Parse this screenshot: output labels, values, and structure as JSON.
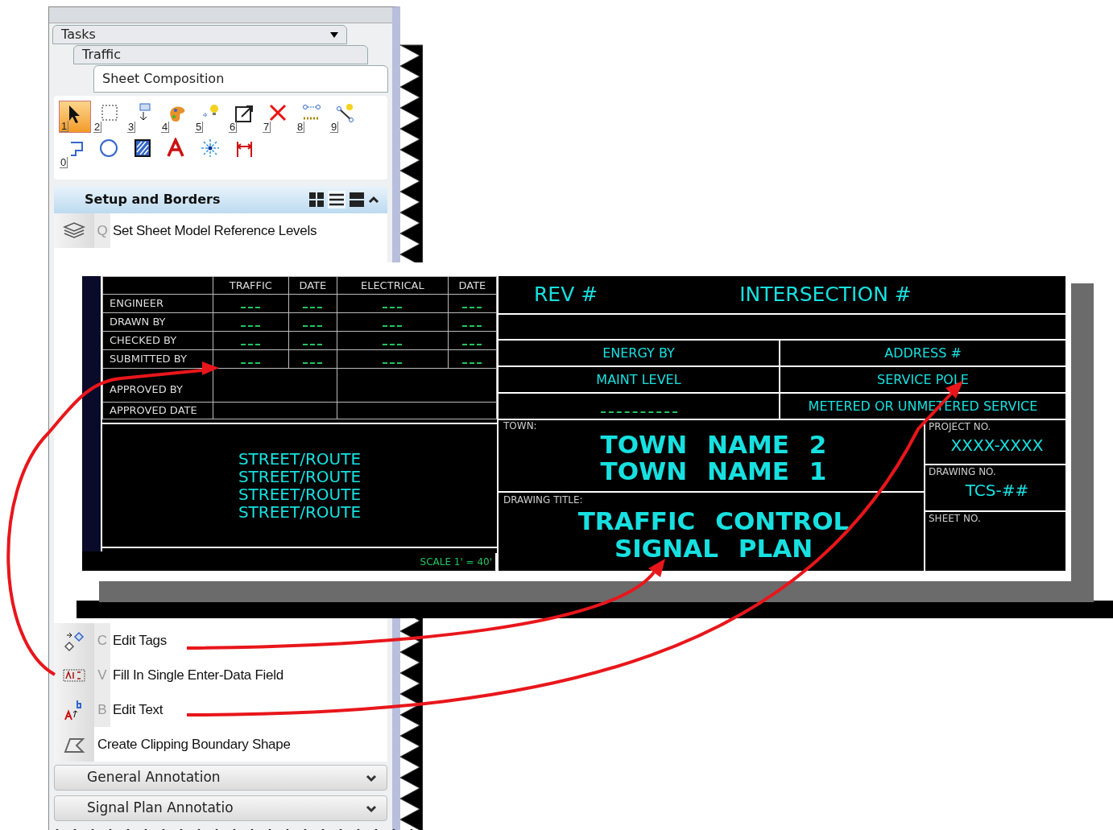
{
  "panel": {
    "task_path": [
      {
        "label": "Tasks",
        "selected": false
      },
      {
        "label": "Traffic",
        "selected": false
      },
      {
        "label": "Sheet Composition",
        "selected": true
      }
    ],
    "tools": [
      {
        "key": "1",
        "kind": "pointer",
        "selected": true
      },
      {
        "key": "2",
        "kind": "fence",
        "selected": false
      },
      {
        "key": "3",
        "kind": "place",
        "selected": false
      },
      {
        "key": "4",
        "kind": "palette",
        "selected": false
      },
      {
        "key": "5",
        "kind": "bulb",
        "selected": false
      },
      {
        "key": "6",
        "kind": "scale",
        "selected": false
      },
      {
        "key": "7",
        "kind": "delete",
        "selected": false
      },
      {
        "key": "8",
        "kind": "connect",
        "selected": false
      },
      {
        "key": "9",
        "kind": "link",
        "selected": false
      },
      {
        "key": "0",
        "kind": "shape",
        "selected": false
      },
      {
        "kind": "circle",
        "selected": false
      },
      {
        "kind": "hatch",
        "selected": false
      },
      {
        "kind": "text",
        "selected": false
      },
      {
        "kind": "snap",
        "selected": false
      },
      {
        "kind": "dimension",
        "selected": false
      }
    ],
    "section": {
      "title": "Setup and Borders",
      "expanded": true
    },
    "items": [
      {
        "key": "Q",
        "label": "Set Sheet Model Reference Levels",
        "kind": "layers"
      },
      {
        "key": "C",
        "label": "Edit Tags",
        "kind": "tags"
      },
      {
        "key": "V",
        "label": "Fill In Single Enter-Data Field",
        "kind": "abc"
      },
      {
        "key": "B",
        "label": "Edit Text",
        "kind": "edittext"
      },
      {
        "label": "Create Clipping Boundary Shape",
        "kind": "clip"
      }
    ],
    "collapsed_sections": [
      {
        "title": "General Annotation",
        "expanded": false
      },
      {
        "title": "Signal Plan Annotatio",
        "expanded": false
      }
    ]
  },
  "title_block": {
    "signoff_columns": [
      "TRAFFIC",
      "DATE",
      "ELECTRICAL",
      "DATE"
    ],
    "signoff_rows": [
      "ENGINEER",
      "DRAWN BY",
      "CHECKED BY",
      "SUBMITTED BY"
    ],
    "approval_rows": [
      "APPROVED BY",
      "APPROVED DATE"
    ],
    "street_lines": [
      "STREET/ROUTE",
      "STREET/ROUTE",
      "STREET/ROUTE",
      "STREET/ROUTE"
    ],
    "scale": "SCALE 1' = 40'",
    "rev": "REV #",
    "intersection": "INTERSECTION #",
    "info_rows": [
      {
        "left": "ENERGY BY",
        "right": "ADDRESS #"
      },
      {
        "left": "MAINT LEVEL",
        "right": "SERVICE POLE"
      },
      {
        "right": "METERED OR UNMETERED SERVICE"
      }
    ],
    "town_label": "TOWN:",
    "town_lines": [
      "TOWN NAME 2",
      "TOWN NAME 1"
    ],
    "drawing_title_label": "DRAWING TITLE:",
    "drawing_title_lines": [
      "TRAFFIC CONTROL",
      "SIGNAL PLAN"
    ],
    "project_label": "PROJECT NO.",
    "project_no": "XXXX-XXXX",
    "drawing_no_label": "DRAWING NO.",
    "drawing_no": "TCS-##",
    "sheet_no_label": "SHEET NO."
  }
}
